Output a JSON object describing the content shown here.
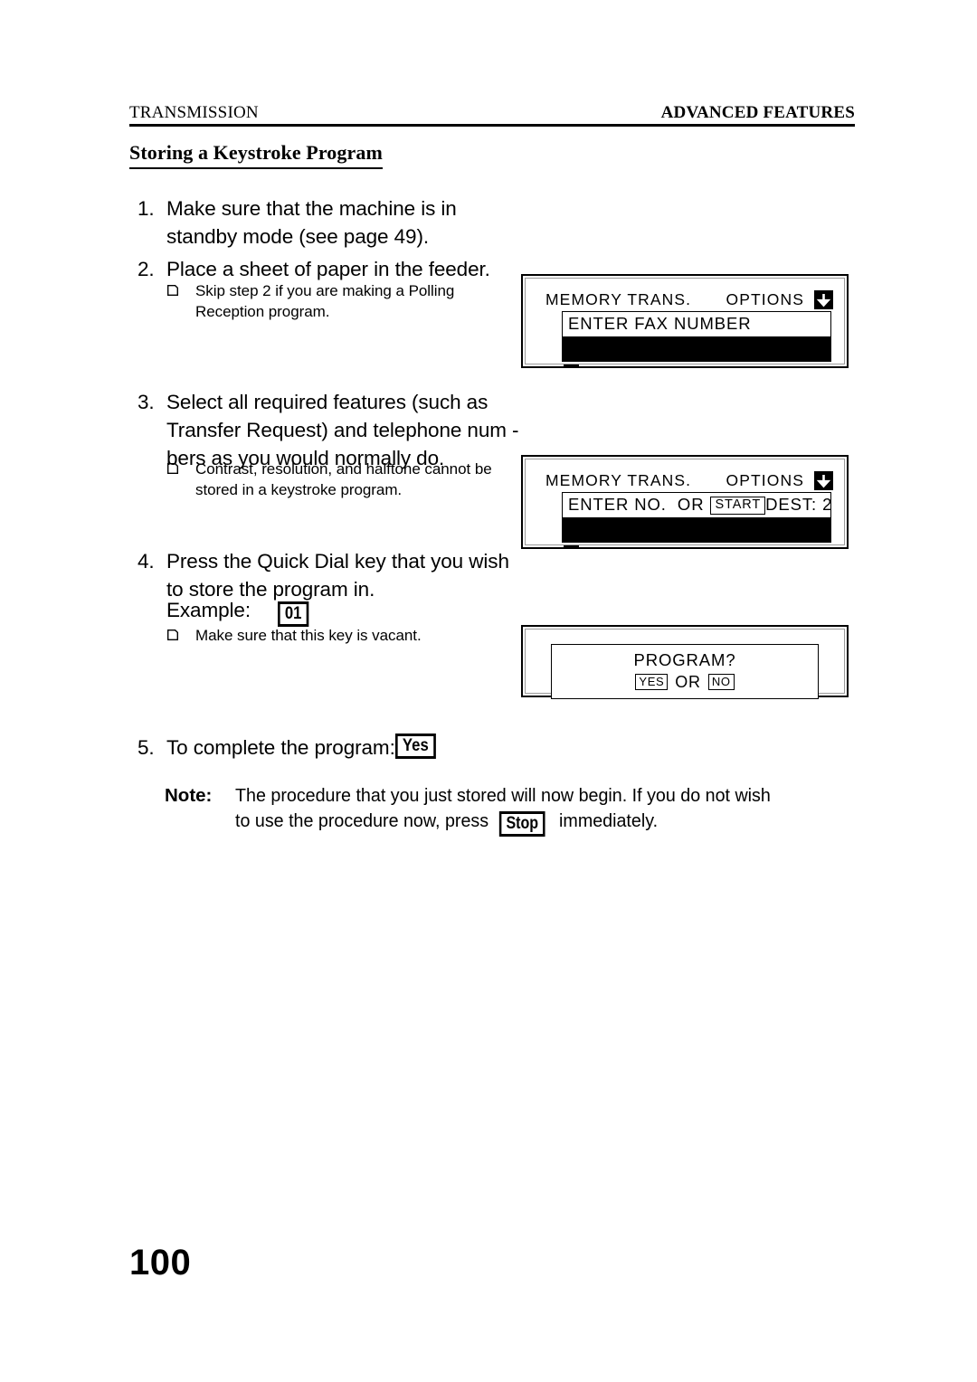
{
  "header": {
    "left": "TRANSMISSION",
    "right": "ADVANCED FEATURES"
  },
  "section_title": "Storing a Keystroke Program",
  "steps": [
    {
      "num": "1.",
      "text": "Make sure that the machine is in standby mode (see page  49)."
    },
    {
      "num": "2.",
      "text": "Place a sheet of paper in the feeder."
    },
    {
      "num": "3.",
      "text": "Select all required features (such as Transfer Request) and telephone num - bers as you would normally do."
    },
    {
      "num": "4.",
      "text": "Press the Quick Dial key that you wish to store the program in.",
      "example_label": "Example:",
      "example_key": "01"
    },
    {
      "num": "5.",
      "text": "To complete the program:",
      "key": "Yes"
    }
  ],
  "sub_notes": [
    {
      "bullet": "notch-square-bullet-icon",
      "text": "Skip step 2 if you are making a Polling Reception program."
    },
    {
      "bullet": "notch-square-bullet-icon",
      "text": "Contrast, resolution, and halftone cannot be stored in a keystroke program."
    },
    {
      "bullet": "notch-square-bullet-icon",
      "text": "Make sure that this key is vacant."
    }
  ],
  "note": {
    "label": "Note:",
    "text_before_key": "The procedure that you just stored will now begin. If you do not wish to use the procedure now, press",
    "key": "Stop",
    "text_after_key": "immediately."
  },
  "lcd_panels": [
    {
      "id": "panel-memory-trans-fax-number",
      "status_left": "MEMORY TRANS.",
      "status_right": "OPTIONS",
      "arrow_icon": "down-arrow-icon",
      "screen_line1_left": "ENTER FAX NUMBER",
      "screen_line1_right": "",
      "has_black_row": true,
      "has_cursor": true
    },
    {
      "id": "panel-memory-trans-enter-no",
      "status_left": "MEMORY TRANS.",
      "status_right": "OPTIONS",
      "arrow_icon": "down-arrow-icon",
      "screen_line1_left_a": "ENTER NO.  OR",
      "screen_line1_key": "START",
      "screen_line1_right": "DEST: 2",
      "has_black_row": true,
      "has_cursor": true
    },
    {
      "id": "panel-program-confirm",
      "prompt": "PROGRAM?",
      "yes_key": "YES",
      "or_text": "OR",
      "no_key": "NO"
    }
  ],
  "page_number": "100"
}
